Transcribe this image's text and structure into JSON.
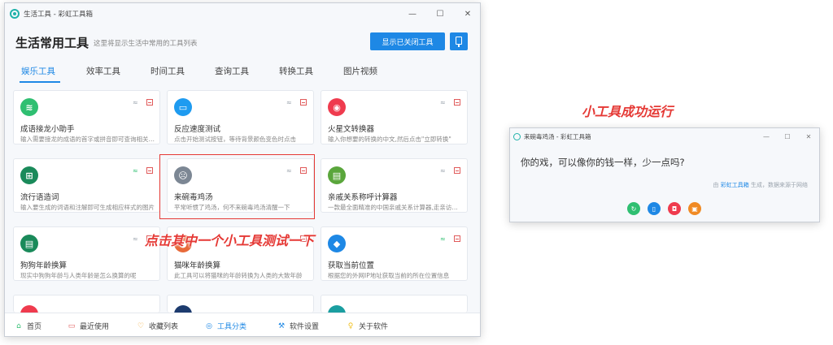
{
  "window": {
    "title": "生活工具 - 彩虹工具箱",
    "controls": [
      "—",
      "☐",
      "✕"
    ]
  },
  "header": {
    "title": "生活常用工具",
    "subtitle": "这里将显示生活中常用的工具列表",
    "toggle_button": "显示已关闭工具"
  },
  "tabs": [
    {
      "label": "娱乐工具",
      "active": true
    },
    {
      "label": "效率工具",
      "active": false
    },
    {
      "label": "时间工具",
      "active": false
    },
    {
      "label": "查询工具",
      "active": false
    },
    {
      "label": "转换工具",
      "active": false
    },
    {
      "label": "图片视频",
      "active": false
    }
  ],
  "cards": [
    {
      "title": "成语接龙小助手",
      "desc": "输入需要接龙的成语的首字或拼音即可查询相关成语",
      "icon": "receipt-icon",
      "color": "#2fbf71",
      "online": false
    },
    {
      "title": "反应速度测试",
      "desc": "点击开始测试按钮，等待背景颜色变色时点击",
      "icon": "gamepad-icon",
      "color": "#1e9bf0",
      "online": false
    },
    {
      "title": "火星文转换器",
      "desc": "输入你想要的转换的中文,然后点击\"立即转换\"",
      "icon": "fire-icon",
      "color": "#ef3b4e",
      "online": false
    },
    {
      "title": "流行语造词",
      "desc": "输入要生成的词语和注解即可生成相应样式的图片",
      "icon": "grid-icon",
      "color": "#1a8a5a",
      "online": true
    },
    {
      "title": "来碗毒鸡汤",
      "desc": "平常听惯了鸡汤，何不来碗毒鸡汤清醒一下",
      "icon": "sad-face-icon",
      "color": "#7c8794",
      "online": false
    },
    {
      "title": "亲戚关系称呼计算器",
      "desc": "一款最全面精准的中国亲戚关系计算器,走亲访友必备",
      "icon": "calculator-icon",
      "color": "#5aa63c",
      "online": false
    },
    {
      "title": "狗狗年龄换算",
      "desc": "现实中狗狗年龄与人类年龄是怎么换算的呢",
      "icon": "dog-icon",
      "color": "#1a8a5a",
      "online": false
    },
    {
      "title": "猫咪年龄换算",
      "desc": "此工具可以将猫咪的年龄转换为人类的大致年龄",
      "icon": "cat-icon",
      "color": "#e86a3a",
      "online": false
    },
    {
      "title": "获取当前位置",
      "desc": "根据您的外网IP地址获取当前的所在位置信息",
      "icon": "location-icon",
      "color": "#1e88e5",
      "online": true
    }
  ],
  "card_icons": {
    "receipt": "≋",
    "gamepad": "▭",
    "fire": "◉",
    "grid": "⊞",
    "sad": "☹",
    "calc": "▤",
    "dog": "▤",
    "cat": "●",
    "location": "◆"
  },
  "annotations": {
    "click_hint": "点击其中一个小工具测试一下",
    "run_hint": "小工具成功运行"
  },
  "bottom_nav": [
    {
      "label": "首页",
      "icon": "home-icon",
      "active": false
    },
    {
      "label": "最近使用",
      "icon": "folder-icon",
      "active": false
    },
    {
      "label": "收藏列表",
      "icon": "heart-icon",
      "active": false
    },
    {
      "label": "工具分类",
      "icon": "category-icon",
      "active": true
    },
    {
      "label": "软件设置",
      "icon": "wrench-icon",
      "active": false
    },
    {
      "label": "关于软件",
      "icon": "bulb-icon",
      "active": false
    }
  ],
  "popup": {
    "title": "来碗毒鸡汤 - 彩虹工具箱",
    "message": "你的戏，可以像你的钱一样，少一点吗?",
    "footer_prefix": "由",
    "footer_link": "彩虹工具箱",
    "footer_suffix": "生成，数据来源于网络",
    "buttons": [
      {
        "icon": "refresh-icon",
        "color": "#2fbf71"
      },
      {
        "icon": "copy-icon",
        "color": "#1e88e5"
      },
      {
        "icon": "camera-icon",
        "color": "#ef3b4e"
      },
      {
        "icon": "image-icon",
        "color": "#f08a24"
      }
    ]
  }
}
